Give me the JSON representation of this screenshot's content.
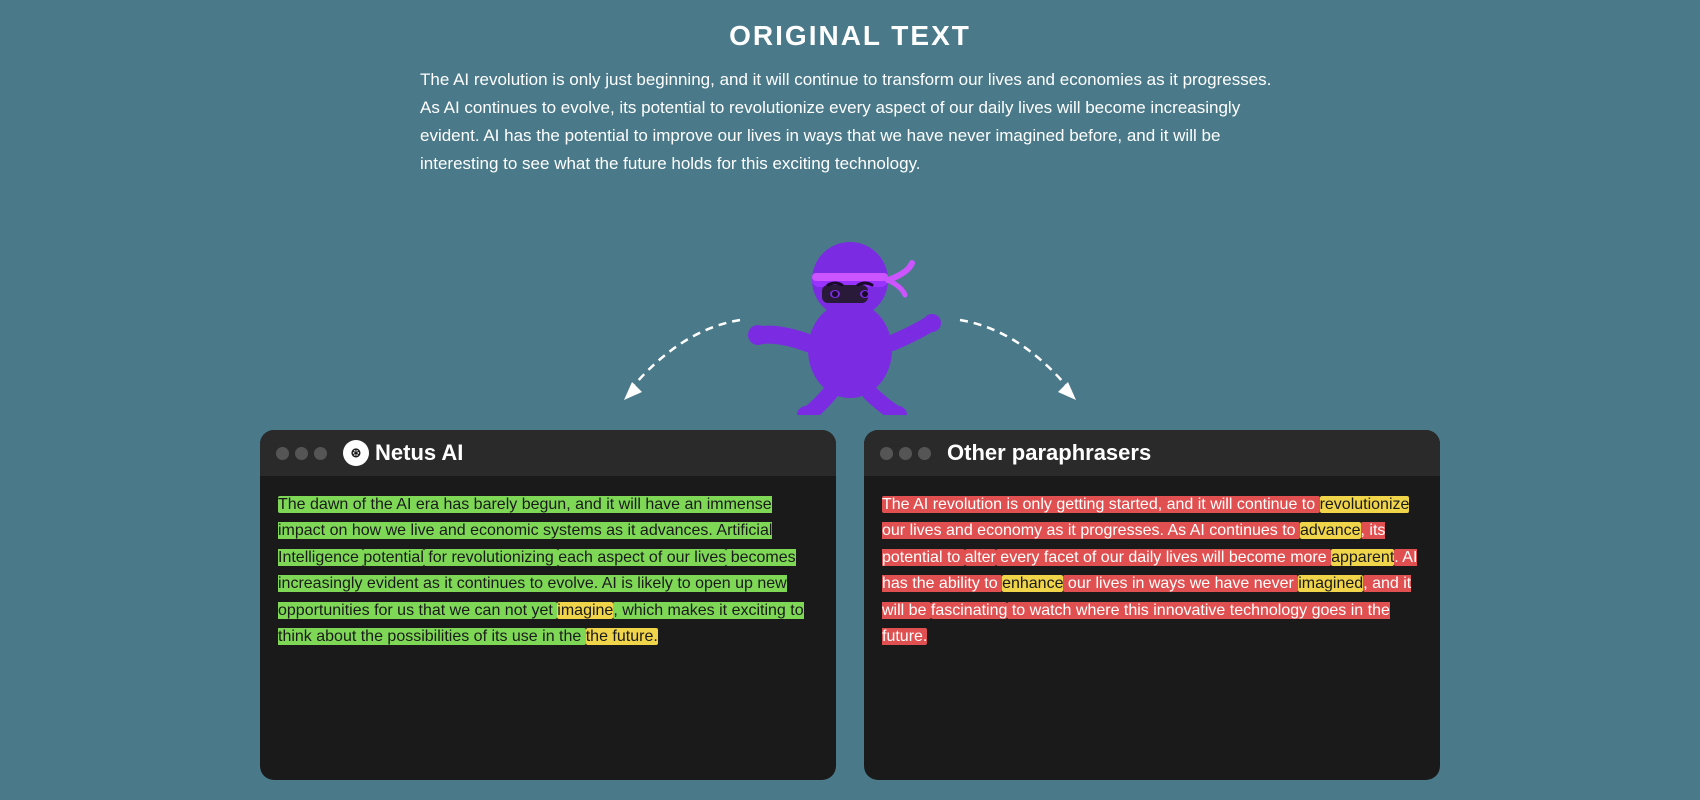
{
  "page": {
    "background_color": "#4a7a8a",
    "title": "ORIGINAL TEXT",
    "original_text": "The AI revolution is only just beginning, and it will continue to transform our lives and economies as it progresses. As AI continues to evolve, its potential to revolutionize every aspect of our daily lives will become increasingly evident. AI has the potential to improve our lives in ways that we have never imagined before, and it will be interesting to see what the future holds for this exciting technology.",
    "netus_panel": {
      "title": "Netus AI",
      "logo_symbol": "N",
      "text_segments": [
        {
          "text": "The dawn of the AI era has barely begun, and it will have an immense impact on how we live and economic systems as it advances. Artificial Intelligence potential for revolutionizing each aspect of our lives becomes increasingly evident as it continues to evolve. AI is likely to open up new opportunities for us that we can not yet imagine, which makes it exciting to think about the possibilities of its use in the future.",
          "highlights": [
            {
              "phrase": "The dawn of the AI era has barely begun, and it will have an immense impact on how we live and economic systems as it advances. Artificial Intelligence",
              "color": "green"
            },
            {
              "phrase": "potential",
              "color": "green"
            },
            {
              "phrase": "for revolutionizing each aspect of our lives",
              "color": "green"
            },
            {
              "phrase": "becomes increasingly evident as it continues to evolve. AI is likely to open up new opportunities for us that we can not yet",
              "color": "green"
            },
            {
              "phrase": "imagine",
              "color": "yellow"
            },
            {
              "phrase": ", which makes it exciting to think about the possibilities of its use in the future.",
              "color": "green"
            },
            {
              "phrase": "the future.",
              "color": "yellow"
            }
          ]
        }
      ]
    },
    "other_panel": {
      "title": "Other paraphrasers",
      "text_segments": [
        {
          "text": "The AI revolution is only getting started, and it will continue to revolutionize our lives and economy as it progresses. As AI continues to advance, its potential to alter every facet of our daily lives will become more apparent. AI has the ability to enhance our lives in ways we have never imagined, and it will be fascinating to watch where this innovative technology goes in the future."
        }
      ]
    }
  }
}
